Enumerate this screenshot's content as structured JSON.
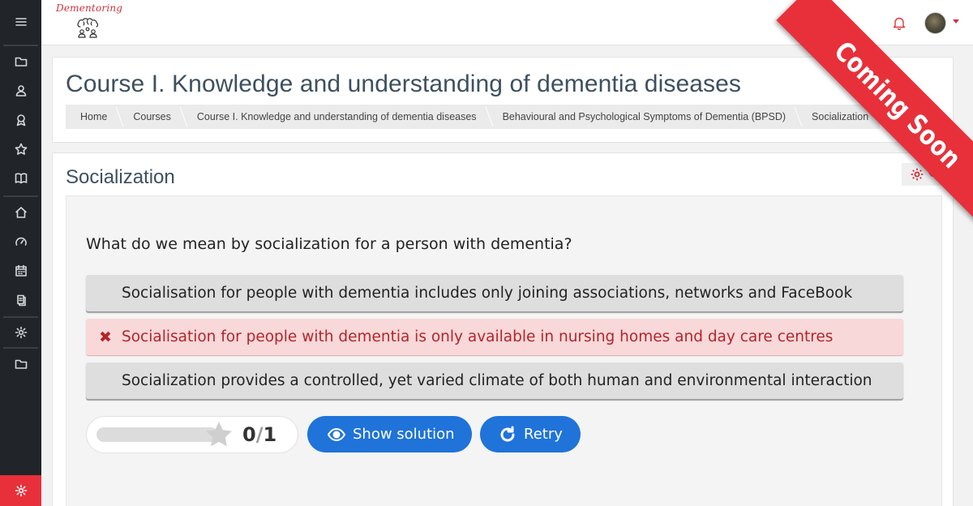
{
  "header": {
    "logo_text": "Dementoring",
    "ribbon_text": "Coming Soon"
  },
  "nav": {
    "items": [
      "menu-icon",
      "folder-icon",
      "user-icon",
      "award-icon",
      "star-icon",
      "book-icon",
      "home-icon",
      "dashboard-icon",
      "calendar-icon",
      "files-icon",
      "gear-icon",
      "folder-icon",
      "gear-icon"
    ],
    "accent": "#e8303a"
  },
  "course": {
    "title": "Course I. Knowledge and understanding of dementia diseases",
    "breadcrumb": [
      "Home",
      "Courses",
      "Course I. Knowledge and understanding of dementia diseases",
      "Behavioural and Psychological Symptoms of Dementia (BPSD)",
      "Socialization"
    ]
  },
  "activity": {
    "title": "Socialization",
    "question": "What do we mean by socialization for a person with dementia?",
    "answers": [
      {
        "text": "Socialisation for people with dementia includes only joining associations, networks and FaceBook",
        "state": "normal"
      },
      {
        "text": "Socialisation for people with dementia is only available in nursing homes and day care centres",
        "state": "wrong"
      },
      {
        "text": "Socialization provides a controlled, yet varied climate of both human and environmental interaction",
        "state": "normal"
      }
    ],
    "score": {
      "current": "0",
      "separator": "/",
      "max": "1",
      "fraction": 0
    },
    "show_solution_label": "Show solution",
    "retry_label": "Retry"
  },
  "colors": {
    "primary_button": "#1f73d9",
    "wrong_bg": "#f8d8d9",
    "wrong_text": "#b3252a",
    "title": "#3d5060"
  }
}
